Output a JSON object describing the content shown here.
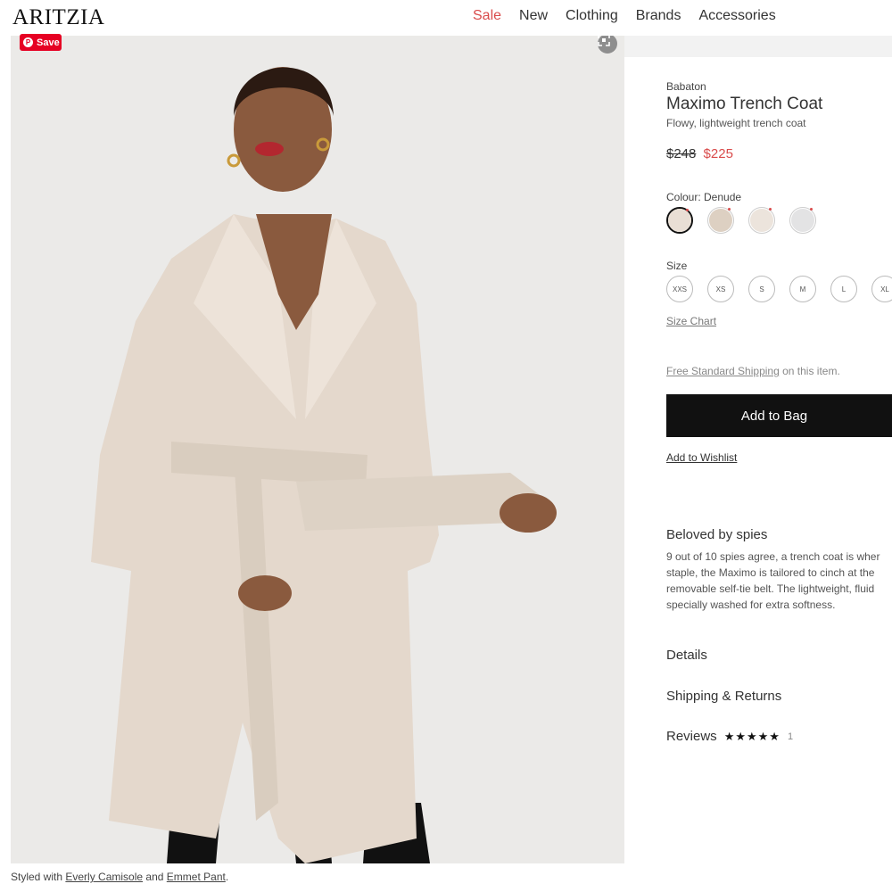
{
  "header": {
    "logo": "ARITZIA",
    "nav": [
      "Sale",
      "New",
      "Clothing",
      "Brands",
      "Accessories"
    ]
  },
  "image": {
    "pin_save_label": "Save"
  },
  "styled_with": {
    "prefix": "Styled with",
    "item1": "Everly Camisole",
    "conjunction": "and",
    "item2": "Emmet Pant",
    "suffix": "."
  },
  "product": {
    "brand": "Babaton",
    "title": "Maximo Trench Coat",
    "subtitle": "Flowy, lightweight trench coat",
    "price_old": "$248",
    "price_new": "$225",
    "colour_label": "Colour: Denude",
    "swatches": [
      {
        "color": "#e9dfd5",
        "selected": true
      },
      {
        "color": "#ddd0c2",
        "selected": false
      },
      {
        "color": "#ece4dc",
        "selected": false
      },
      {
        "color": "#e3e3e4",
        "selected": false
      }
    ],
    "size_label": "Size",
    "sizes": [
      "XXS",
      "XS",
      "S",
      "M",
      "L",
      "XL"
    ],
    "size_chart": "Size Chart",
    "shipping_link": "Free Standard Shipping",
    "shipping_suffix": "on this item.",
    "add_to_bag": "Add to Bag",
    "add_to_wishlist": "Add to Wishlist"
  },
  "description": {
    "heading": "Beloved by spies",
    "lines": [
      "9 out of 10 spies agree, a trench coat is wher",
      "staple, the Maximo is tailored to cinch at the",
      "removable self-tie belt. The lightweight, fluid",
      "specially washed for extra softness."
    ]
  },
  "accordion": {
    "details": "Details",
    "shipping_returns": "Shipping & Returns",
    "reviews": "Reviews",
    "reviews_rating": 5,
    "reviews_stars": "★★★★★",
    "reviews_count": "1"
  },
  "colors": {
    "sale_red": "#d94b4b",
    "button_black": "#111111",
    "pinterest_red": "#e60023"
  }
}
